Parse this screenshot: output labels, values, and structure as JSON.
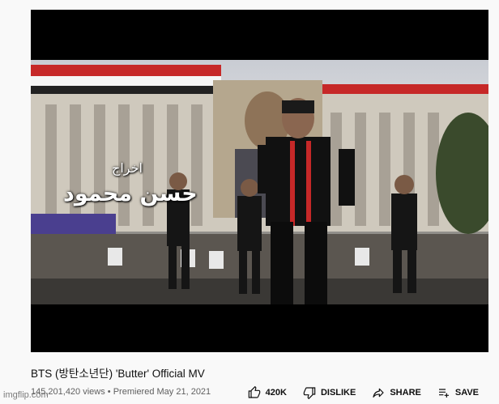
{
  "video": {
    "overlay_line1": "اخراج",
    "overlay_line2": "حسن محمود"
  },
  "info": {
    "title": "BTS (방탄소년단) 'Butter' Official MV",
    "views": "145,201,420 views",
    "separator": "•",
    "premiered": "Premiered May 21, 2021"
  },
  "actions": {
    "like_count": "420K",
    "dislike_label": "DISLIKE",
    "share_label": "SHARE",
    "save_label": "SAVE"
  },
  "icons": [
    "thumbs-up-icon",
    "thumbs-down-icon",
    "share-icon",
    "save-playlist-icon"
  ],
  "watermark": "imgflip.com"
}
